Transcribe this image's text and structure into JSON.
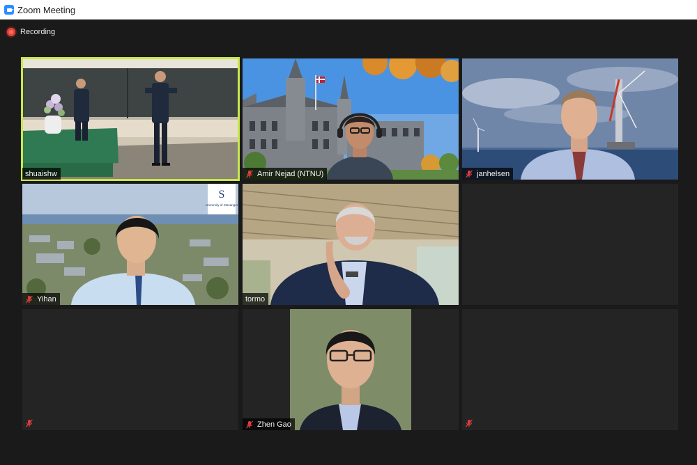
{
  "window": {
    "title": "Zoom Meeting"
  },
  "recording": {
    "label": "Recording"
  },
  "colors": {
    "active_speaker_border": "#c9e84a",
    "recording_red": "#e6453a",
    "muted_red": "#e23d3d",
    "zoom_blue": "#2d8cff"
  },
  "participants": [
    {
      "name": "shuaishw",
      "muted": false,
      "active_speaker": true
    },
    {
      "name": "Amir Nejad (NTNU)",
      "muted": true,
      "active_speaker": false
    },
    {
      "name": "janhelsen",
      "muted": true,
      "active_speaker": false
    },
    {
      "name": "Yihan",
      "muted": true,
      "active_speaker": false
    },
    {
      "name": "tormo",
      "muted": false,
      "active_speaker": false
    },
    {
      "name": "",
      "muted": false,
      "active_speaker": false,
      "empty": true
    },
    {
      "name": "",
      "muted": true,
      "active_speaker": false,
      "video_off": true
    },
    {
      "name": "Zhen Gao",
      "muted": true,
      "active_speaker": false
    },
    {
      "name": "",
      "muted": true,
      "active_speaker": false,
      "video_off": true
    }
  ],
  "icons": {
    "app": "zoom-camera-icon",
    "recording": "recording-dot-icon",
    "mute": "mic-muted-icon"
  },
  "overlays": {
    "uis_logo_text": "University of Stavanger",
    "uis_logo_letter": "S"
  }
}
